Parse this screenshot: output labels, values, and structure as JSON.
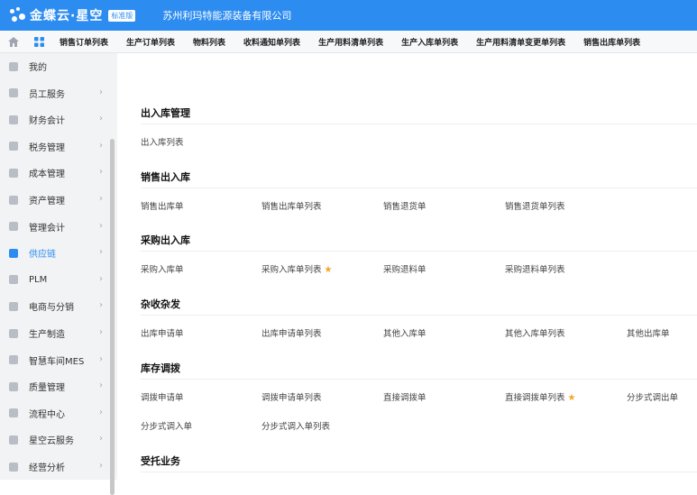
{
  "brand": {
    "name": "金蝶云·星空",
    "badge": "标准版",
    "company": "苏州利玛特能源装备有限公司"
  },
  "tabs": [
    "销售订单列表",
    "生产订单列表",
    "物料列表",
    "收料通知单列表",
    "生产用料清单列表",
    "生产入库单列表",
    "生产用料清单变更单列表",
    "销售出库单列表"
  ],
  "sidebar": [
    {
      "label": "我的",
      "chevron": false
    },
    {
      "label": "员工服务",
      "chevron": true
    },
    {
      "label": "财务会计",
      "chevron": true
    },
    {
      "label": "税务管理",
      "chevron": true
    },
    {
      "label": "成本管理",
      "chevron": true
    },
    {
      "label": "资产管理",
      "chevron": true
    },
    {
      "label": "管理会计",
      "chevron": true
    },
    {
      "label": "供应链",
      "chevron": true,
      "active": true
    },
    {
      "label": "PLM",
      "chevron": true
    },
    {
      "label": "电商与分销",
      "chevron": true
    },
    {
      "label": "生产制造",
      "chevron": true
    },
    {
      "label": "智慧车间MES",
      "chevron": true
    },
    {
      "label": "质量管理",
      "chevron": true
    },
    {
      "label": "流程中心",
      "chevron": true
    },
    {
      "label": "星空云服务",
      "chevron": true
    },
    {
      "label": "经营分析",
      "chevron": true
    }
  ],
  "sections": [
    {
      "title": "出入库管理",
      "links": [
        {
          "label": "出入库列表"
        }
      ]
    },
    {
      "title": "销售出入库",
      "links": [
        {
          "label": "销售出库单"
        },
        {
          "label": "销售出库单列表"
        },
        {
          "label": "销售退货单"
        },
        {
          "label": "销售退货单列表"
        }
      ]
    },
    {
      "title": "采购出入库",
      "links": [
        {
          "label": "采购入库单"
        },
        {
          "label": "采购入库单列表",
          "star": true
        },
        {
          "label": "采购退料单"
        },
        {
          "label": "采购退料单列表"
        }
      ]
    },
    {
      "title": "杂收杂发",
      "links": [
        {
          "label": "出库申请单"
        },
        {
          "label": "出库申请单列表"
        },
        {
          "label": "其他入库单"
        },
        {
          "label": "其他入库单列表"
        },
        {
          "label": "其他出库单"
        }
      ]
    },
    {
      "title": "库存调拨",
      "links": [
        {
          "label": "调拨申请单"
        },
        {
          "label": "调拨申请单列表"
        },
        {
          "label": "直接调拨单"
        },
        {
          "label": "直接调拨单列表",
          "star": true
        },
        {
          "label": "分步式调出单"
        },
        {
          "label": "分步式调入单"
        },
        {
          "label": "分步式调入单列表"
        }
      ]
    },
    {
      "title": "受托业务",
      "links": []
    }
  ]
}
